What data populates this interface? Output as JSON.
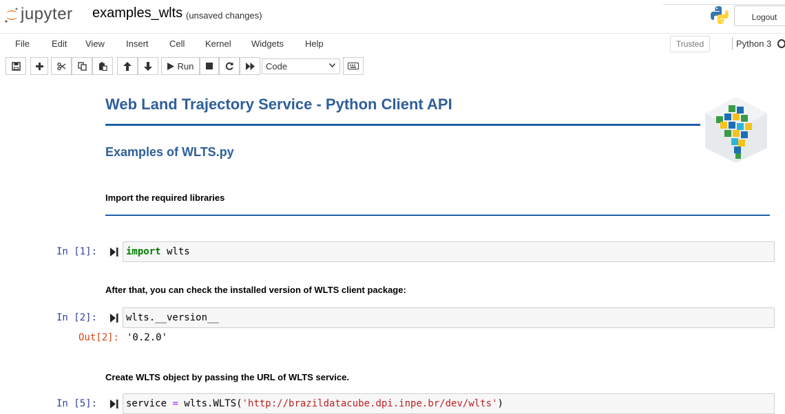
{
  "header": {
    "logo_text": "jupyter",
    "notebook_name": "examples_wlts",
    "save_status": "(unsaved changes)",
    "logout_label": "Logout"
  },
  "menu": {
    "items": [
      "File",
      "Edit",
      "View",
      "Insert",
      "Cell",
      "Kernel",
      "Widgets",
      "Help"
    ],
    "trusted_label": "Trusted",
    "kernel_name": "Python 3"
  },
  "toolbar": {
    "run_label": "Run",
    "cell_type": "Code"
  },
  "notebook": {
    "title": "Web Land Trajectory Service - Python Client API",
    "subtitle": "Examples of WLTS.py",
    "md_import": "Import the required libraries",
    "md_version": "After that, you can check the installed version of WLTS client package:",
    "md_create": "Create WLTS object by passing the URL of WLTS service.",
    "cells": [
      {
        "prompt": "In [1]:",
        "code": {
          "keyword": "import",
          "rest": " wlts"
        }
      },
      {
        "prompt": "In [2]:",
        "code": {
          "text": "wlts.__version__"
        },
        "out_prompt": "Out[2]:",
        "output": "'0.2.0'"
      },
      {
        "prompt": "In [5]:",
        "code": {
          "lhs": "service ",
          "op": "=",
          "mid": " wlts.WLTS(",
          "str": "'http://brazildatacube.dpi.inpe.br/dev/wlts'",
          "end": ")"
        }
      }
    ]
  },
  "colors": {
    "heading_blue": "#2e5f9a",
    "rule_blue": "#1f5fa8",
    "prompt_in": "#303f9f",
    "prompt_out": "#d84315",
    "keyword_green": "#008000",
    "string_red": "#ba2121"
  }
}
